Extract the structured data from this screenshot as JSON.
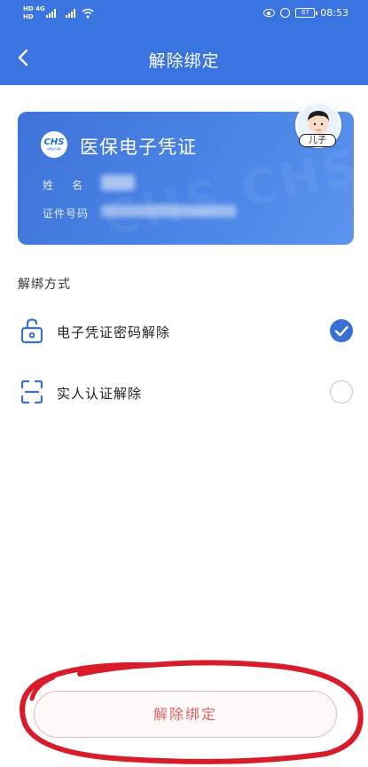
{
  "status_bar": {
    "network_line1": "HD 4G",
    "network_line2": "HD",
    "battery": "87",
    "time": "08:53"
  },
  "nav": {
    "title": "解除绑定",
    "back_icon": "chevron-left-icon"
  },
  "card": {
    "logo_mark": "CHS",
    "logo_sub": "中国医疗保障",
    "title": "医保电子凭证",
    "name_label": "姓名",
    "id_label": "证件号码",
    "avatar_badge": "儿子",
    "gradient_start": "#3f73d9",
    "gradient_end": "#5b95ee"
  },
  "methods": {
    "section_label": "解绑方式",
    "items": [
      {
        "label": "电子凭证密码解除",
        "icon": "unlock-icon",
        "selected": true
      },
      {
        "label": "实人认证解除",
        "icon": "face-scan-icon",
        "selected": false
      }
    ]
  },
  "footer": {
    "unbind_label": "解除绑定"
  },
  "colors": {
    "primary": "#3a74e0",
    "check": "#3a6fd6",
    "danger_text": "#e06262",
    "annotation": "#d81c2a"
  }
}
